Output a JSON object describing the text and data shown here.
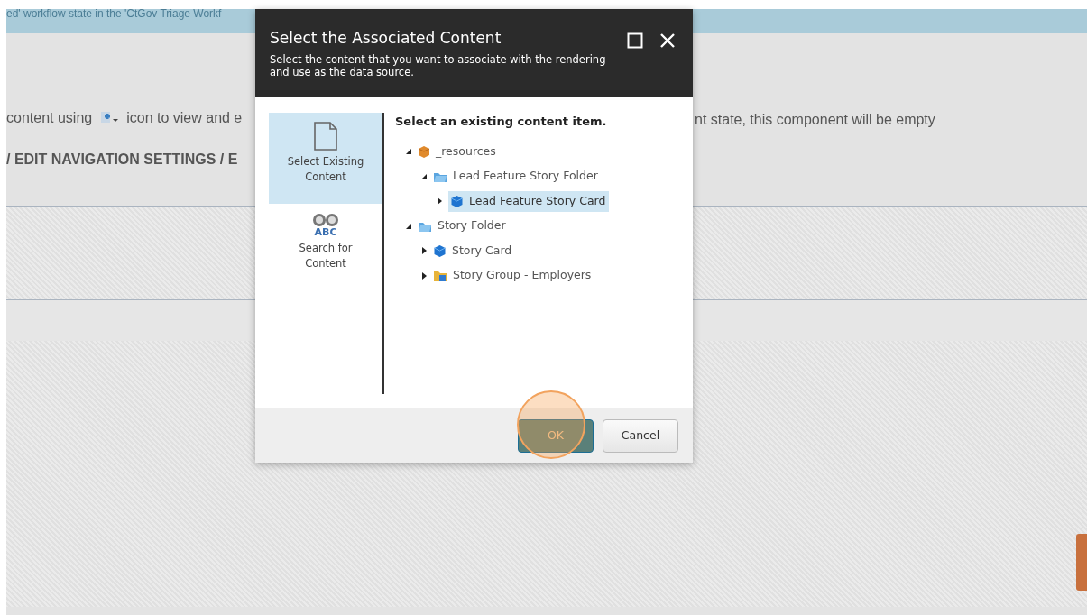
{
  "background": {
    "banner_text": "ed' workflow state in the 'CtGov Triage Workf",
    "instruction_left": "content using",
    "instruction_middle": "icon to view and e",
    "instruction_right": "nt state, this component will be empty",
    "heading": "/ EDIT NAVIGATION SETTINGS / E"
  },
  "dialog": {
    "title": "Select the Associated Content",
    "subtitle": "Select the content that you want to associate with the rendering and use as the data source.",
    "modes": [
      {
        "label": "Select Existing Content",
        "kind": "page",
        "selected": true
      },
      {
        "label": "Search for Content",
        "kind": "binoculars",
        "icon_text": "ABC",
        "selected": false
      }
    ],
    "tree_heading": "Select an existing content item.",
    "tree": [
      {
        "label": "_resources",
        "kind": "package",
        "expanded": true,
        "selected": false,
        "children": [
          {
            "label": "Lead Feature Story Folder",
            "kind": "folder",
            "expanded": true,
            "selected": false,
            "children": [
              {
                "label": "Lead Feature Story Card",
                "kind": "cube",
                "expanded": false,
                "selected": true
              }
            ]
          }
        ]
      },
      {
        "label": "Story Folder",
        "kind": "folder",
        "expanded": true,
        "selected": false,
        "children": [
          {
            "label": "Story Card",
            "kind": "cube",
            "expanded": false,
            "selected": false
          },
          {
            "label": "Story Group - Employers",
            "kind": "group",
            "expanded": false,
            "selected": false
          }
        ]
      }
    ],
    "buttons": [
      {
        "label": "OK",
        "kind": "primary",
        "highlighted": true
      },
      {
        "label": "Cancel",
        "kind": "secondary",
        "highlighted": false
      }
    ]
  }
}
